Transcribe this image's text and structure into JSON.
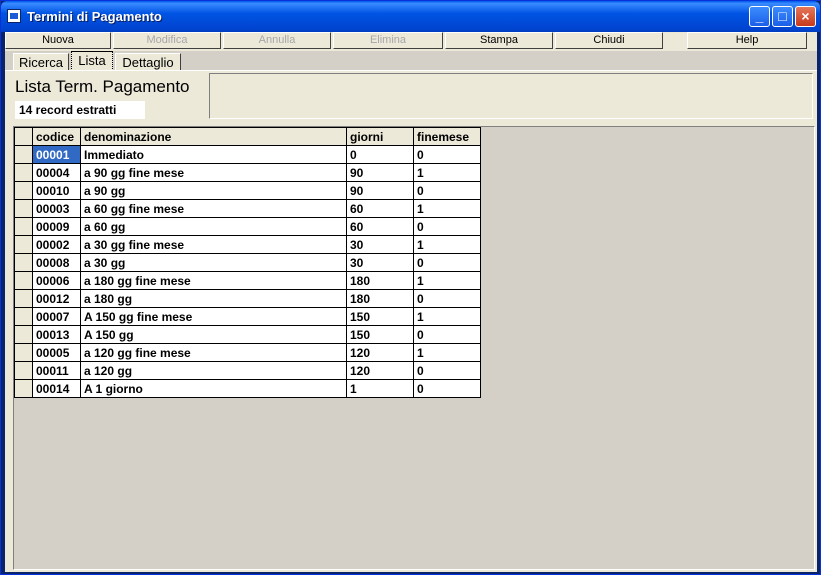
{
  "window": {
    "title": "Termini di Pagamento"
  },
  "title_buttons": {
    "minimize": "_",
    "maximize": "□",
    "close": "×"
  },
  "toolbar": [
    {
      "label": "Nuova",
      "enabled": true
    },
    {
      "label": "Modifica",
      "enabled": false
    },
    {
      "label": "Annulla",
      "enabled": false
    },
    {
      "label": "Elimina",
      "enabled": false
    },
    {
      "label": "Stampa",
      "enabled": true
    },
    {
      "label": "Chiudi",
      "enabled": true
    },
    {
      "label": "Help",
      "enabled": true
    }
  ],
  "tabs": [
    {
      "label": "Ricerca",
      "active": false
    },
    {
      "label": "Lista",
      "active": true
    },
    {
      "label": "Dettaglio",
      "active": false
    }
  ],
  "header": {
    "title": "Lista Term. Pagamento",
    "record_count": "14 record estratti"
  },
  "grid": {
    "columns": [
      "codice",
      "denominazione",
      "giorni",
      "finemese"
    ],
    "rows": [
      [
        "00001",
        "Immediato",
        "0",
        "0"
      ],
      [
        "00004",
        "a 90 gg fine mese",
        "90",
        "1"
      ],
      [
        "00010",
        "a 90 gg",
        "90",
        "0"
      ],
      [
        "00003",
        "a 60 gg fine mese",
        "60",
        "1"
      ],
      [
        "00009",
        "a 60 gg",
        "60",
        "0"
      ],
      [
        "00002",
        "a 30 gg fine mese",
        "30",
        "1"
      ],
      [
        "00008",
        "a 30 gg",
        "30",
        "0"
      ],
      [
        "00006",
        "a 180 gg fine mese",
        "180",
        "1"
      ],
      [
        "00012",
        "a 180 gg",
        "180",
        "0"
      ],
      [
        "00007",
        "A 150 gg fine mese",
        "150",
        "1"
      ],
      [
        "00013",
        "A 150 gg",
        "150",
        "0"
      ],
      [
        "00005",
        "a 120 gg fine mese",
        "120",
        "1"
      ],
      [
        "00011",
        "a 120 gg",
        "120",
        "0"
      ],
      [
        "00014",
        "A 1 giorno",
        "1",
        "0"
      ]
    ],
    "selected_cell": {
      "row": 0,
      "col": 0
    }
  }
}
